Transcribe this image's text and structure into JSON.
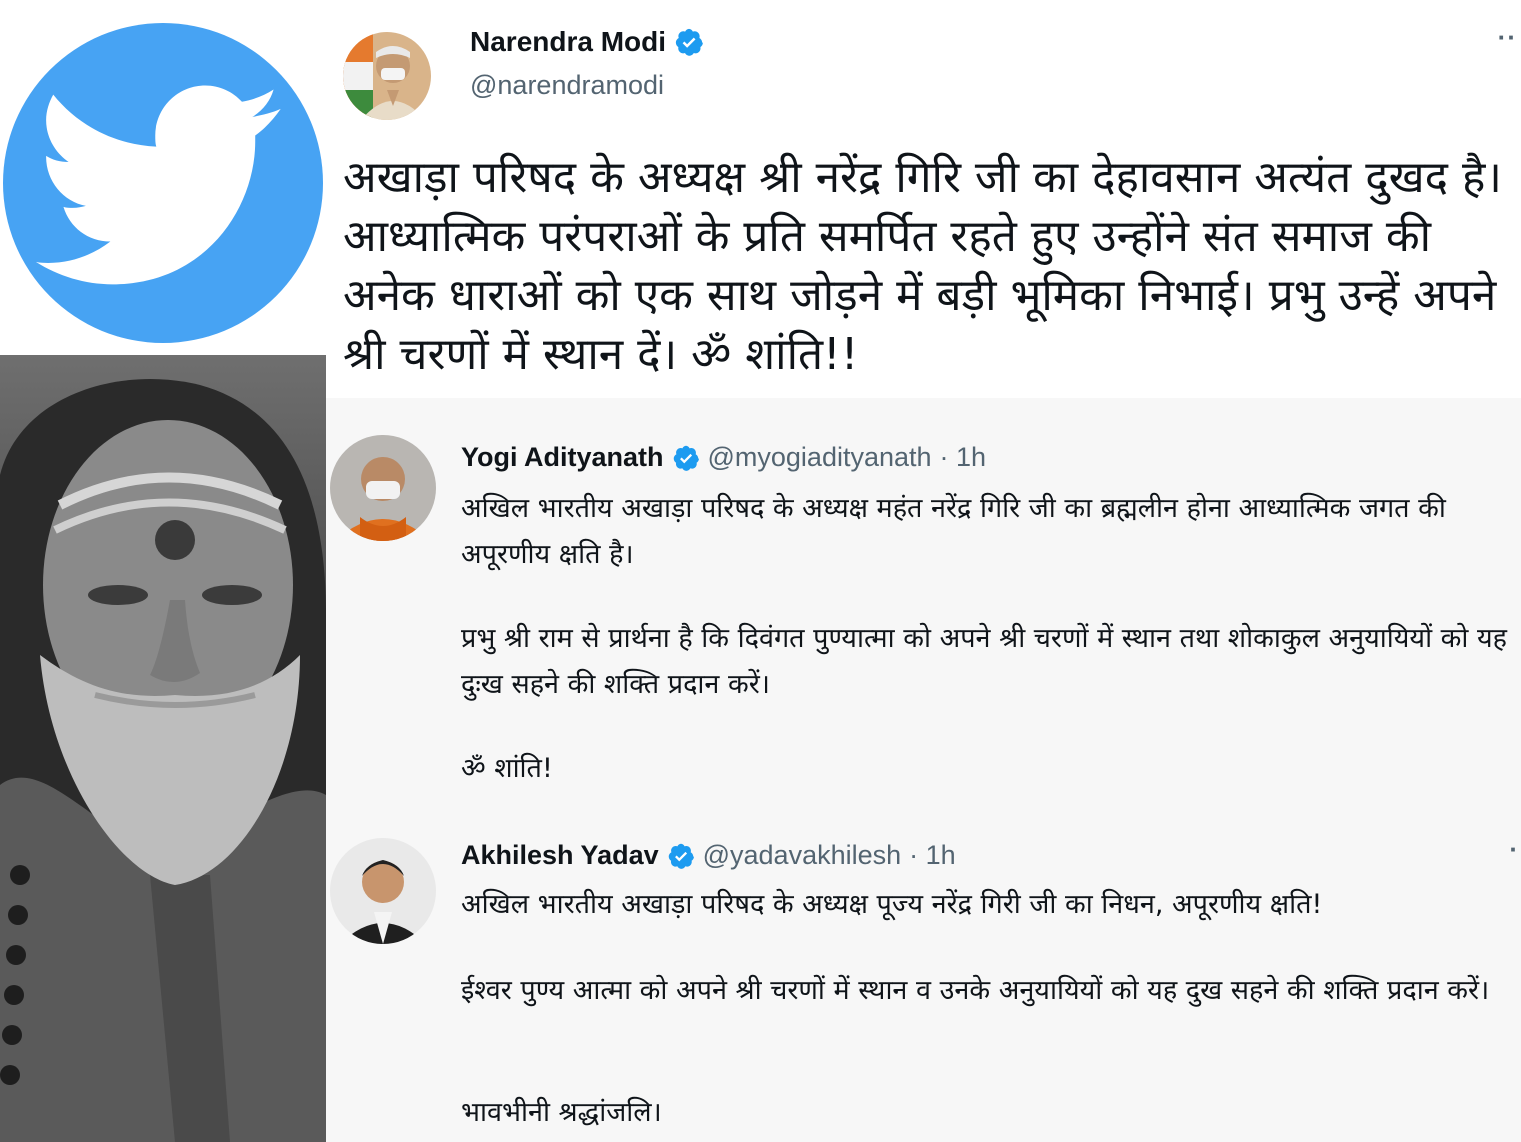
{
  "colors": {
    "twitter_blue": "#47a3f3",
    "verified_blue": "#1d9bf0",
    "handle_gray": "#536471",
    "text_dark": "#0f1419"
  },
  "tweets": [
    {
      "name": "Narendra Modi",
      "handle": "@narendramodi",
      "verified": true,
      "more": "··",
      "text": "अखाड़ा परिषद के अध्यक्ष श्री नरेंद्र गिरि जी का देहावसान अत्यंत दुखद है। आध्यात्मिक परंपराओं के प्रति समर्पित रहते हुए उन्होंने संत समाज की अनेक धाराओं को एक साथ जोड़ने में बड़ी भूमिका निभाई। प्रभु उन्हें अपने श्री चरणों में स्थान दें। ॐ शांति!!"
    },
    {
      "name": "Yogi Adityanath",
      "handle": "@myogiadityanath",
      "time": "· 1h",
      "verified": true,
      "paragraphs": [
        "अखिल भारतीय अखाड़ा परिषद के अध्यक्ष महंत नरेंद्र गिरि जी का ब्रह्मलीन होना आध्यात्मिक जगत की अपूरणीय क्षति है।",
        "प्रभु श्री राम से प्रार्थना है कि दिवंगत पुण्यात्मा को अपने श्री चरणों में स्थान तथा शोकाकुल अनुयायियों को यह दुःख सहने की शक्ति प्रदान करें।",
        "ॐ शांति!"
      ]
    },
    {
      "name": "Akhilesh Yadav",
      "handle": "@yadavakhilesh",
      "time": "· 1h",
      "verified": true,
      "more": "·",
      "paragraphs": [
        "अखिल भारतीय अखाड़ा परिषद के अध्यक्ष पूज्य नरेंद्र गिरी जी का निधन, अपूरणीय क्षति!",
        "ईश्वर पुण्य आत्मा को अपने श्री चरणों में स्थान व उनके अनुयायियों को यह दुख सहने की शक्ति प्रदान करें।",
        "भावभीनी श्रद्धांजलि।"
      ]
    }
  ]
}
